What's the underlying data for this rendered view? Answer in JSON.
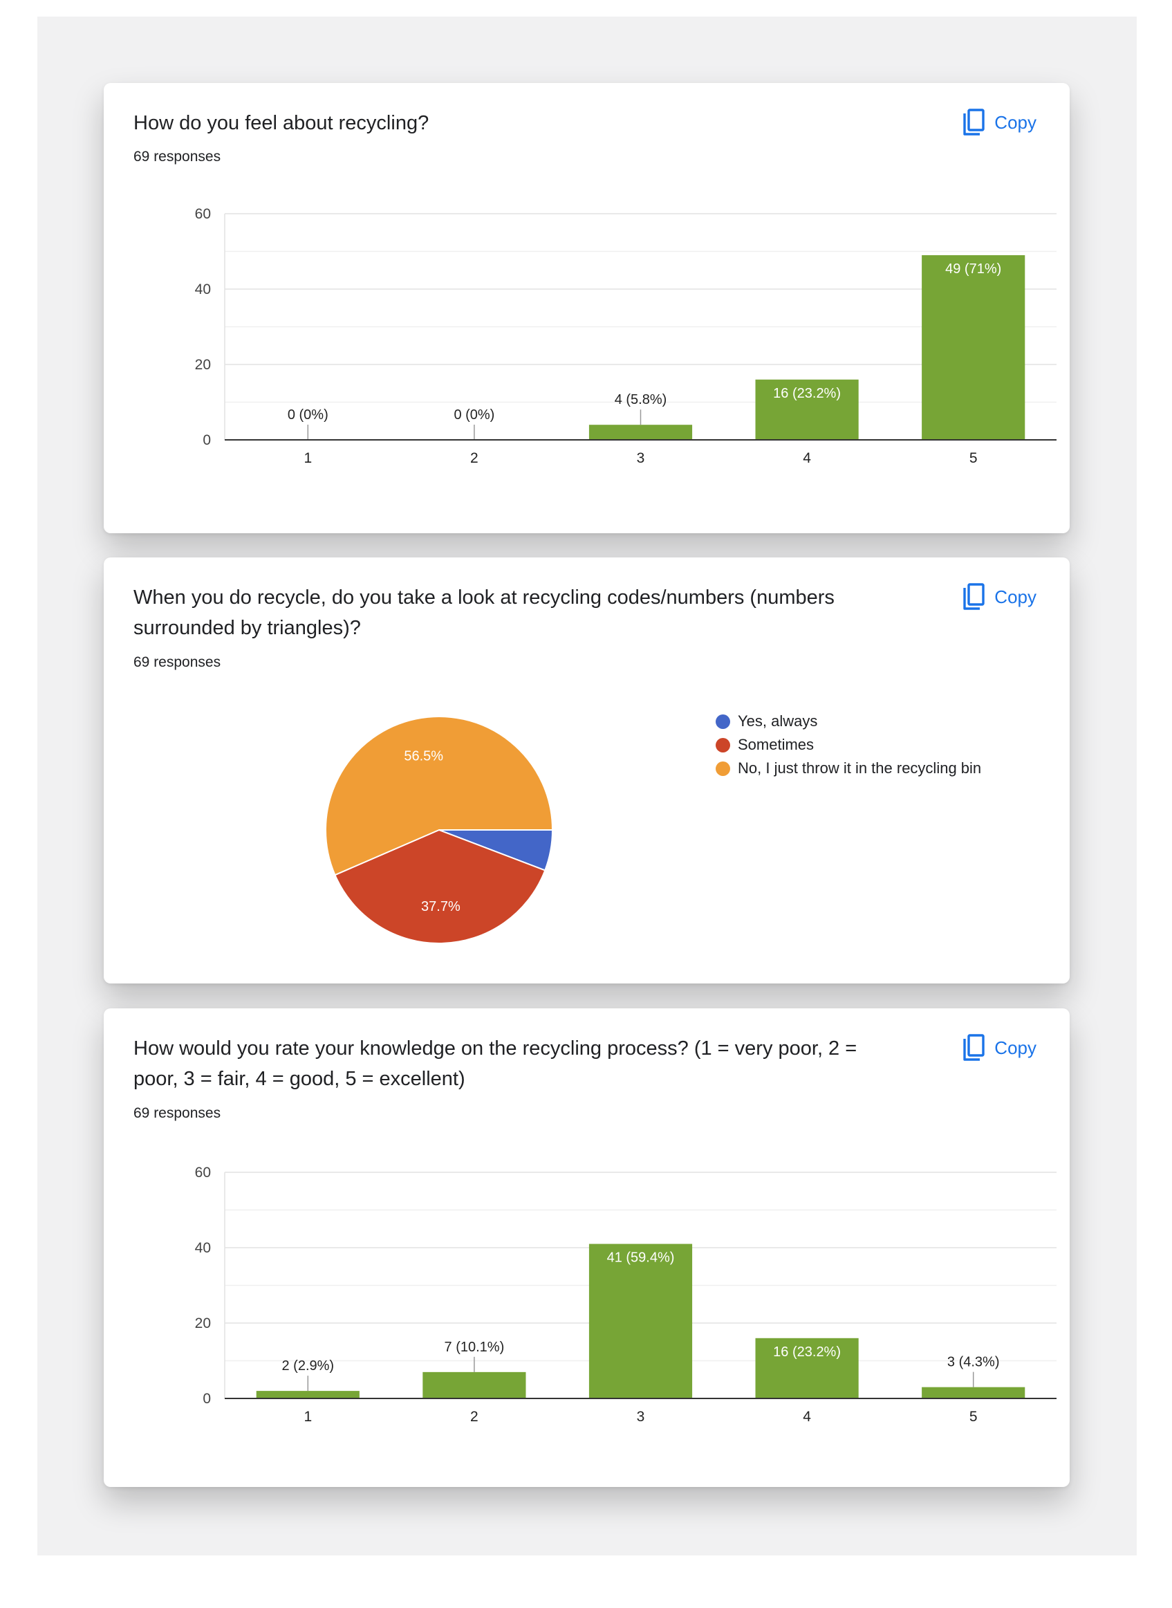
{
  "copy_label": "Copy",
  "cards": [
    {
      "title": "How do you feel about recycling?",
      "responses": "69 responses",
      "chart_data": {
        "type": "bar",
        "categories": [
          "1",
          "2",
          "3",
          "4",
          "5"
        ],
        "values": [
          0,
          0,
          4,
          16,
          49
        ],
        "data_labels": [
          "0 (0%)",
          "0 (0%)",
          "4 (5.8%)",
          "16 (23.2%)",
          "49 (71%)"
        ],
        "ylim": [
          0,
          60
        ],
        "yticks": [
          0,
          20,
          40,
          60
        ],
        "grid": true,
        "color": "#77a536"
      }
    },
    {
      "title": "When you do recycle, do you take a look at recycling codes/numbers (numbers surrounded by triangles)?",
      "responses": "69 responses",
      "chart_data": {
        "type": "pie",
        "labels": [
          "Yes, always",
          "Sometimes",
          "No, I just throw it in the recycling bin"
        ],
        "values": [
          5.8,
          37.7,
          56.5
        ],
        "slice_labels": [
          "",
          "37.7%",
          "56.5%"
        ],
        "colors": [
          "#4366c8",
          "#cc4528",
          "#f09d36"
        ],
        "legend": "right"
      }
    },
    {
      "title": "How would you rate your knowledge on the recycling process?  (1 = very poor, 2 = poor, 3 = fair, 4 = good, 5 = excellent)",
      "responses": "69 responses",
      "chart_data": {
        "type": "bar",
        "categories": [
          "1",
          "2",
          "3",
          "4",
          "5"
        ],
        "values": [
          2,
          7,
          41,
          16,
          3
        ],
        "data_labels": [
          "2 (2.9%)",
          "7 (10.1%)",
          "41 (59.4%)",
          "16 (23.2%)",
          "3 (4.3%)"
        ],
        "ylim": [
          0,
          60
        ],
        "yticks": [
          0,
          20,
          40,
          60
        ],
        "grid": true,
        "color": "#77a536"
      }
    }
  ]
}
